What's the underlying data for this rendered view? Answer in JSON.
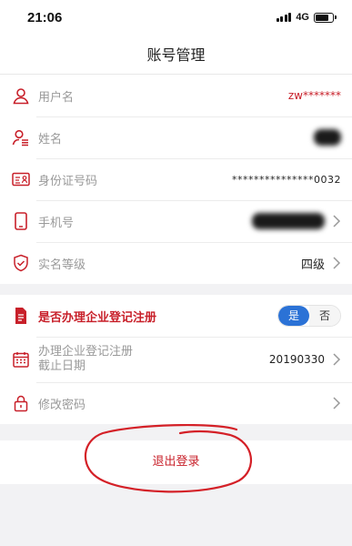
{
  "status": {
    "time": "21:06",
    "network": "4G"
  },
  "nav": {
    "title": "账号管理"
  },
  "account": {
    "username_label": "用户名",
    "username_value": "zw*******",
    "name_label": "姓名",
    "id_label": "身份证号码",
    "id_value": "***************0032",
    "phone_label": "手机号",
    "level_label": "实名等级",
    "level_value": "四级"
  },
  "enterprise": {
    "question_label": "是否办理企业登记注册",
    "yes": "是",
    "no": "否",
    "selected": "是",
    "deadline_label_line1": "办理企业登记注册",
    "deadline_label_line2": "截止日期",
    "deadline_value": "20190330",
    "password_label": "修改密码"
  },
  "logout": {
    "label": "退出登录"
  },
  "colors": {
    "accent_red": "#c8202a",
    "toggle_blue": "#2b72d6"
  },
  "icons": [
    "person-icon",
    "person-list-icon",
    "id-card-icon",
    "phone-icon",
    "shield-check-icon",
    "document-icon",
    "calendar-icon",
    "lock-icon",
    "chevron-right-icon"
  ]
}
